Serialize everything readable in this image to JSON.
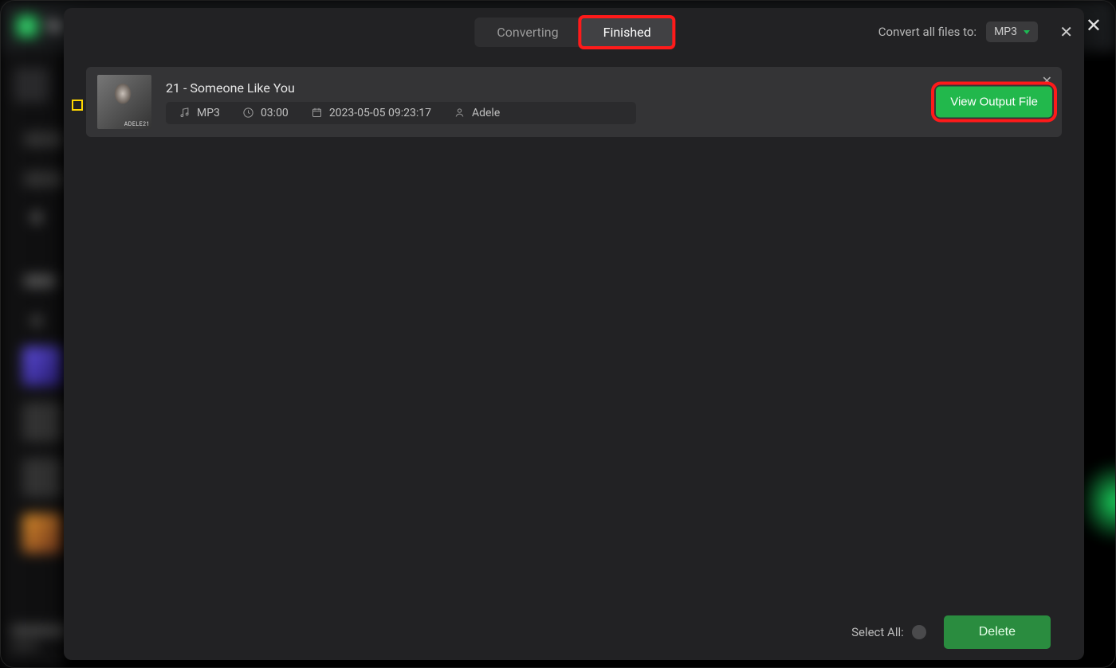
{
  "background": {
    "app_title_fragment": "Sp"
  },
  "modal": {
    "tabs": {
      "converting": "Converting",
      "finished": "Finished"
    },
    "active_tab": "finished",
    "convert_all_label": "Convert all files to:",
    "format_selected": "MP3",
    "tracks": [
      {
        "title": "21 - Someone Like You",
        "format": "MP3",
        "duration": "03:00",
        "timestamp": "2023-05-05 09:23:17",
        "artist": "Adele",
        "view_button": "View Output File"
      }
    ],
    "footer": {
      "select_all_label": "Select All:",
      "delete_label": "Delete"
    }
  }
}
